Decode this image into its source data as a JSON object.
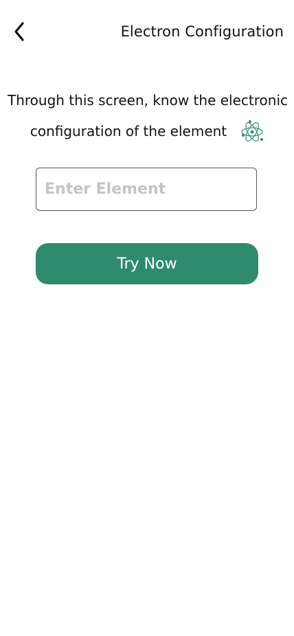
{
  "header": {
    "title": "Electron Configuration",
    "back_icon": "chevron-left-icon"
  },
  "intro": {
    "line1": "Through this screen, know the electronic",
    "line2": "configuration of the element",
    "icon": "atom-icon"
  },
  "form": {
    "element_input_value": "",
    "element_input_placeholder": "Enter Element",
    "submit_label": "Try Now"
  },
  "colors": {
    "accent": "#2f8a6e",
    "placeholder": "#c9c3c3",
    "background": "#ffffff"
  }
}
